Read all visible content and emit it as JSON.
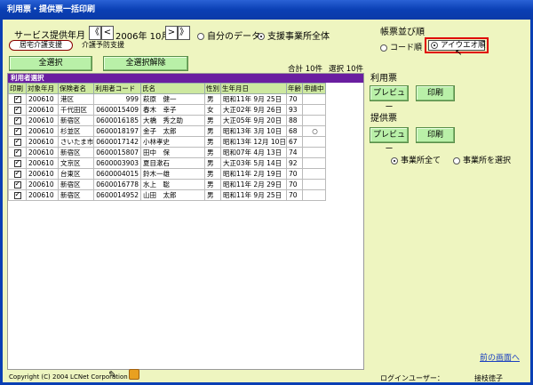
{
  "window": {
    "title": "利用票・提供票一括印刷"
  },
  "service_month": {
    "label": "サービス提供年月",
    "value": "2006年 10月",
    "prev_year": "《",
    "prev_month": "<",
    "next_month": ">",
    "next_year": "》"
  },
  "scope": {
    "own_data": "自分のデータ",
    "all_offices": "支援事業所全体"
  },
  "tabs": {
    "care_support": "居宅介護支援",
    "prevention_support": "介護予防支援"
  },
  "buttons": {
    "select_all": "全選択",
    "deselect_all": "全選択解除"
  },
  "counts": {
    "total": "合計 10件",
    "selected": "選択 10件"
  },
  "table": {
    "title": "利用者選択",
    "headers": [
      "印刷",
      "対象年月",
      "保険者名",
      "利用者コード",
      "氏名",
      "性別",
      "生年月日",
      "年齢",
      "申請中"
    ],
    "rows": [
      [
        "200610",
        "港区",
        "999",
        "萩原　健一",
        "男",
        "昭和11年 9月 25日",
        "70",
        ""
      ],
      [
        "200610",
        "千代田区",
        "0600015409",
        "春木　幸子",
        "女",
        "大正02年 9月 26日",
        "93",
        ""
      ],
      [
        "200610",
        "新宿区",
        "0600016185",
        "大橋　秀之助",
        "男",
        "大正05年 9月 20日",
        "88",
        ""
      ],
      [
        "200610",
        "杉並区",
        "0600018197",
        "金子　太郎",
        "男",
        "昭和13年 3月 10日",
        "68",
        "○"
      ],
      [
        "200610",
        "さいたま市",
        "0600017142",
        "小林孝史",
        "男",
        "昭和13年 12月 10日",
        "67",
        ""
      ],
      [
        "200610",
        "新宿区",
        "0600015807",
        "田中　保",
        "男",
        "昭和07年 4月 13日",
        "74",
        ""
      ],
      [
        "200610",
        "文京区",
        "0600003903",
        "夏目漱石",
        "男",
        "大正03年 5月 14日",
        "92",
        ""
      ],
      [
        "200610",
        "台東区",
        "0600004015",
        "鈴木一雄",
        "男",
        "昭和11年 2月 19日",
        "70",
        ""
      ],
      [
        "200610",
        "新宿区",
        "0600016778",
        "水上　聡",
        "男",
        "昭和11年 2月 29日",
        "70",
        ""
      ],
      [
        "200610",
        "新宿区",
        "0600014952",
        "山田　太郎",
        "男",
        "昭和11年 9月 25日",
        "70",
        ""
      ]
    ]
  },
  "sort": {
    "title": "帳票並び順",
    "code_order": "コード順",
    "kana_order": "アイウエオ順"
  },
  "usage_slip": {
    "title": "利用票",
    "preview": "プレビュー",
    "print": "印刷"
  },
  "provision_slip": {
    "title": "提供票",
    "preview": "プレビュー",
    "print": "印刷"
  },
  "office_scope": {
    "all": "事業所全て",
    "select": "事業所を選択"
  },
  "back_link": "前の画面へ",
  "footer": {
    "copyright": "Copyright (C) 2004 LCNet Corporation",
    "login_label": "ログインユーザー：",
    "login_user": "接枝徳子"
  }
}
